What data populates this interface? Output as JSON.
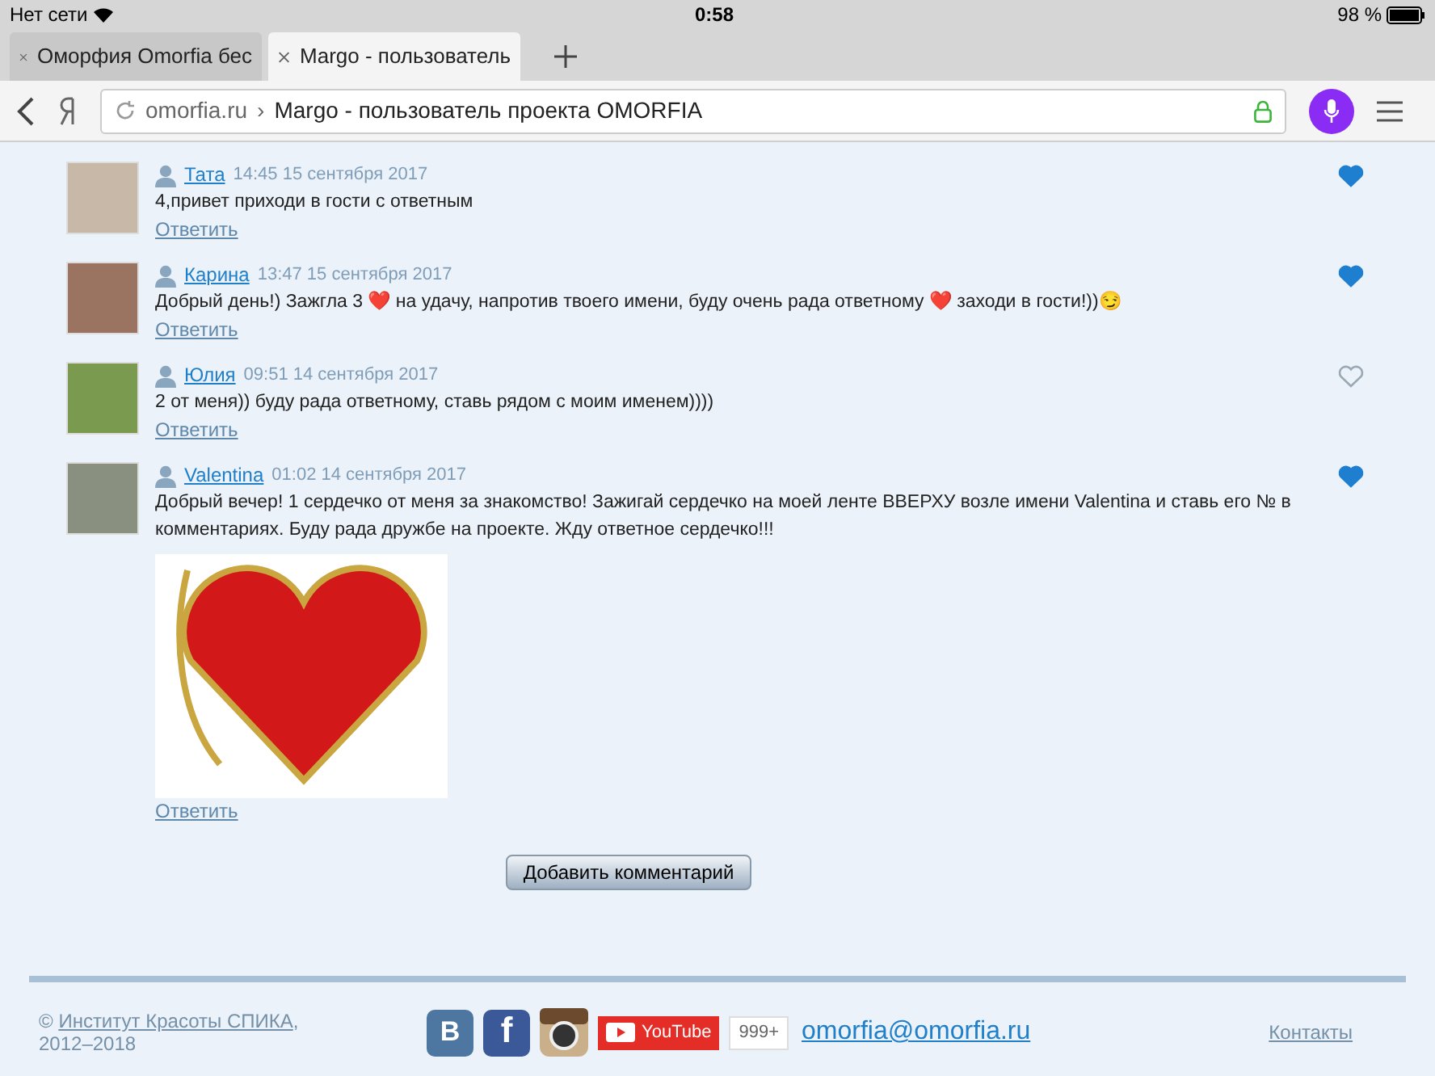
{
  "status_bar": {
    "carrier": "Нет сети",
    "time": "0:58",
    "battery": "98 %"
  },
  "tabs": [
    {
      "title": "Оморфия Omorfia бес",
      "selected": false
    },
    {
      "title": "Margo - пользователь",
      "selected": true
    }
  ],
  "address_bar": {
    "domain": "omorfia.ru",
    "separator": "›",
    "page_title": "Margo - пользователь проекта OMORFIA"
  },
  "comments": [
    {
      "author": "Тата",
      "date": "14:45 15 сентября 2017",
      "text": "4,привет приходи в гости с ответным",
      "reply": "Ответить",
      "liked": true,
      "kind": "text"
    },
    {
      "author": "Карина",
      "date": "13:47 15 сентября 2017",
      "text": "Добрый день!) Зажгла 3 ❤️ на удачу, напротив твоего имени, буду очень рада ответному ❤️ заходи в гости!))😏",
      "reply": "Ответить",
      "liked": true,
      "kind": "text"
    },
    {
      "author": "Юлия",
      "date": "09:51 14 сентября 2017",
      "text": "2 от меня)) буду рада ответному, ставь рядом с моим именем))))",
      "reply": "Ответить",
      "liked": false,
      "kind": "text"
    },
    {
      "author": "Valentina",
      "date": "01:02 14 сентября 2017",
      "text": "Добрый вечер! 1 сердечко от меня за знакомство! Зажигай сердечко на моей ленте ВВЕРХУ возле имени Valentina и ставь его № в комментариях. Буду рада дружбе на проекте. Жду ответное сердечко!!!",
      "reply": "Ответить",
      "liked": true,
      "kind": "picture"
    }
  ],
  "add_comment_button": "Добавить комментарий",
  "footer": {
    "copyright_sign": "©",
    "org_link": "Институт Красоты СПИКА",
    "comma": ",",
    "years": "2012–2018",
    "vk_label": "B",
    "fb_label": "f",
    "youtube_label": "YouTube",
    "youtube_count": "999+",
    "email": "omorfia@omorfia.ru",
    "contacts": "Контакты"
  }
}
